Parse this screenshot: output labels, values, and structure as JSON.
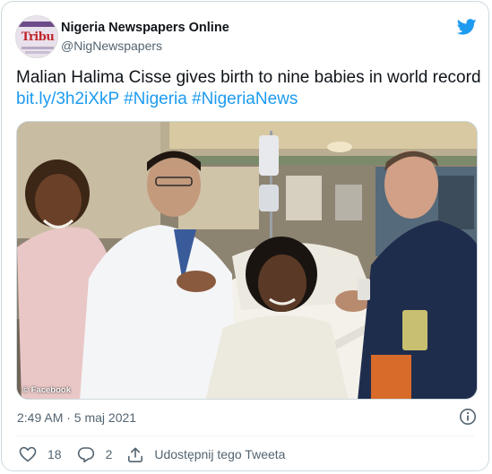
{
  "account": {
    "display_name": "Nigeria Newspapers Online",
    "handle": "@NigNewspapers",
    "avatar_text": "Tribu"
  },
  "tweet": {
    "text_prefix": "Malian Halima Cisse  gives birth to nine babies in world record ",
    "links": [
      "bit.ly/3h2iXkP",
      "#Nigeria",
      "#NigeriaNews"
    ]
  },
  "media": {
    "credit": "© Facebook"
  },
  "meta": {
    "timestamp": "2:49 AM · 5 maj 2021"
  },
  "actions": {
    "likes": "18",
    "replies": "2",
    "share_label": "Udostępnij tego Tweeta"
  },
  "colors": {
    "accent": "#1d9bf0",
    "muted": "#536471",
    "text": "#0f1419"
  },
  "icons": [
    "twitter-bird-icon",
    "info-icon",
    "heart-icon",
    "reply-icon",
    "share-icon"
  ]
}
